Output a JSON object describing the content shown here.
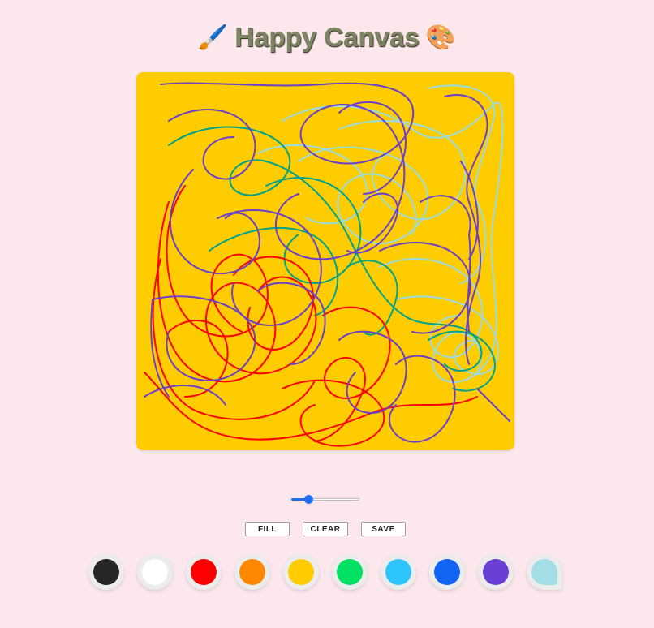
{
  "app": {
    "title": "Happy Canvas",
    "title_left_emoji": "🖌️",
    "title_right_emoji": "🎨"
  },
  "canvas": {
    "background": "#ffcc00",
    "stroke_colors": [
      "#6a3fc9",
      "#ff0000",
      "#9adbe0",
      "#00a389"
    ]
  },
  "brush_size": {
    "value": 0.25
  },
  "buttons": {
    "fill_label": "FILL",
    "clear_label": "CLEAR",
    "save_label": "SAVE"
  },
  "palette": [
    {
      "name": "black",
      "color": "#262626"
    },
    {
      "name": "white",
      "color": "#ffffff"
    },
    {
      "name": "red",
      "color": "#ff0000"
    },
    {
      "name": "orange",
      "color": "#ff8800"
    },
    {
      "name": "yellow",
      "color": "#ffcc00"
    },
    {
      "name": "green",
      "color": "#00e063"
    },
    {
      "name": "sky-blue",
      "color": "#2ec5ff"
    },
    {
      "name": "blue",
      "color": "#1264f2"
    },
    {
      "name": "purple",
      "color": "#6a3fd6"
    },
    {
      "name": "light-blue",
      "color": "#a3dde6",
      "selected": true
    }
  ]
}
